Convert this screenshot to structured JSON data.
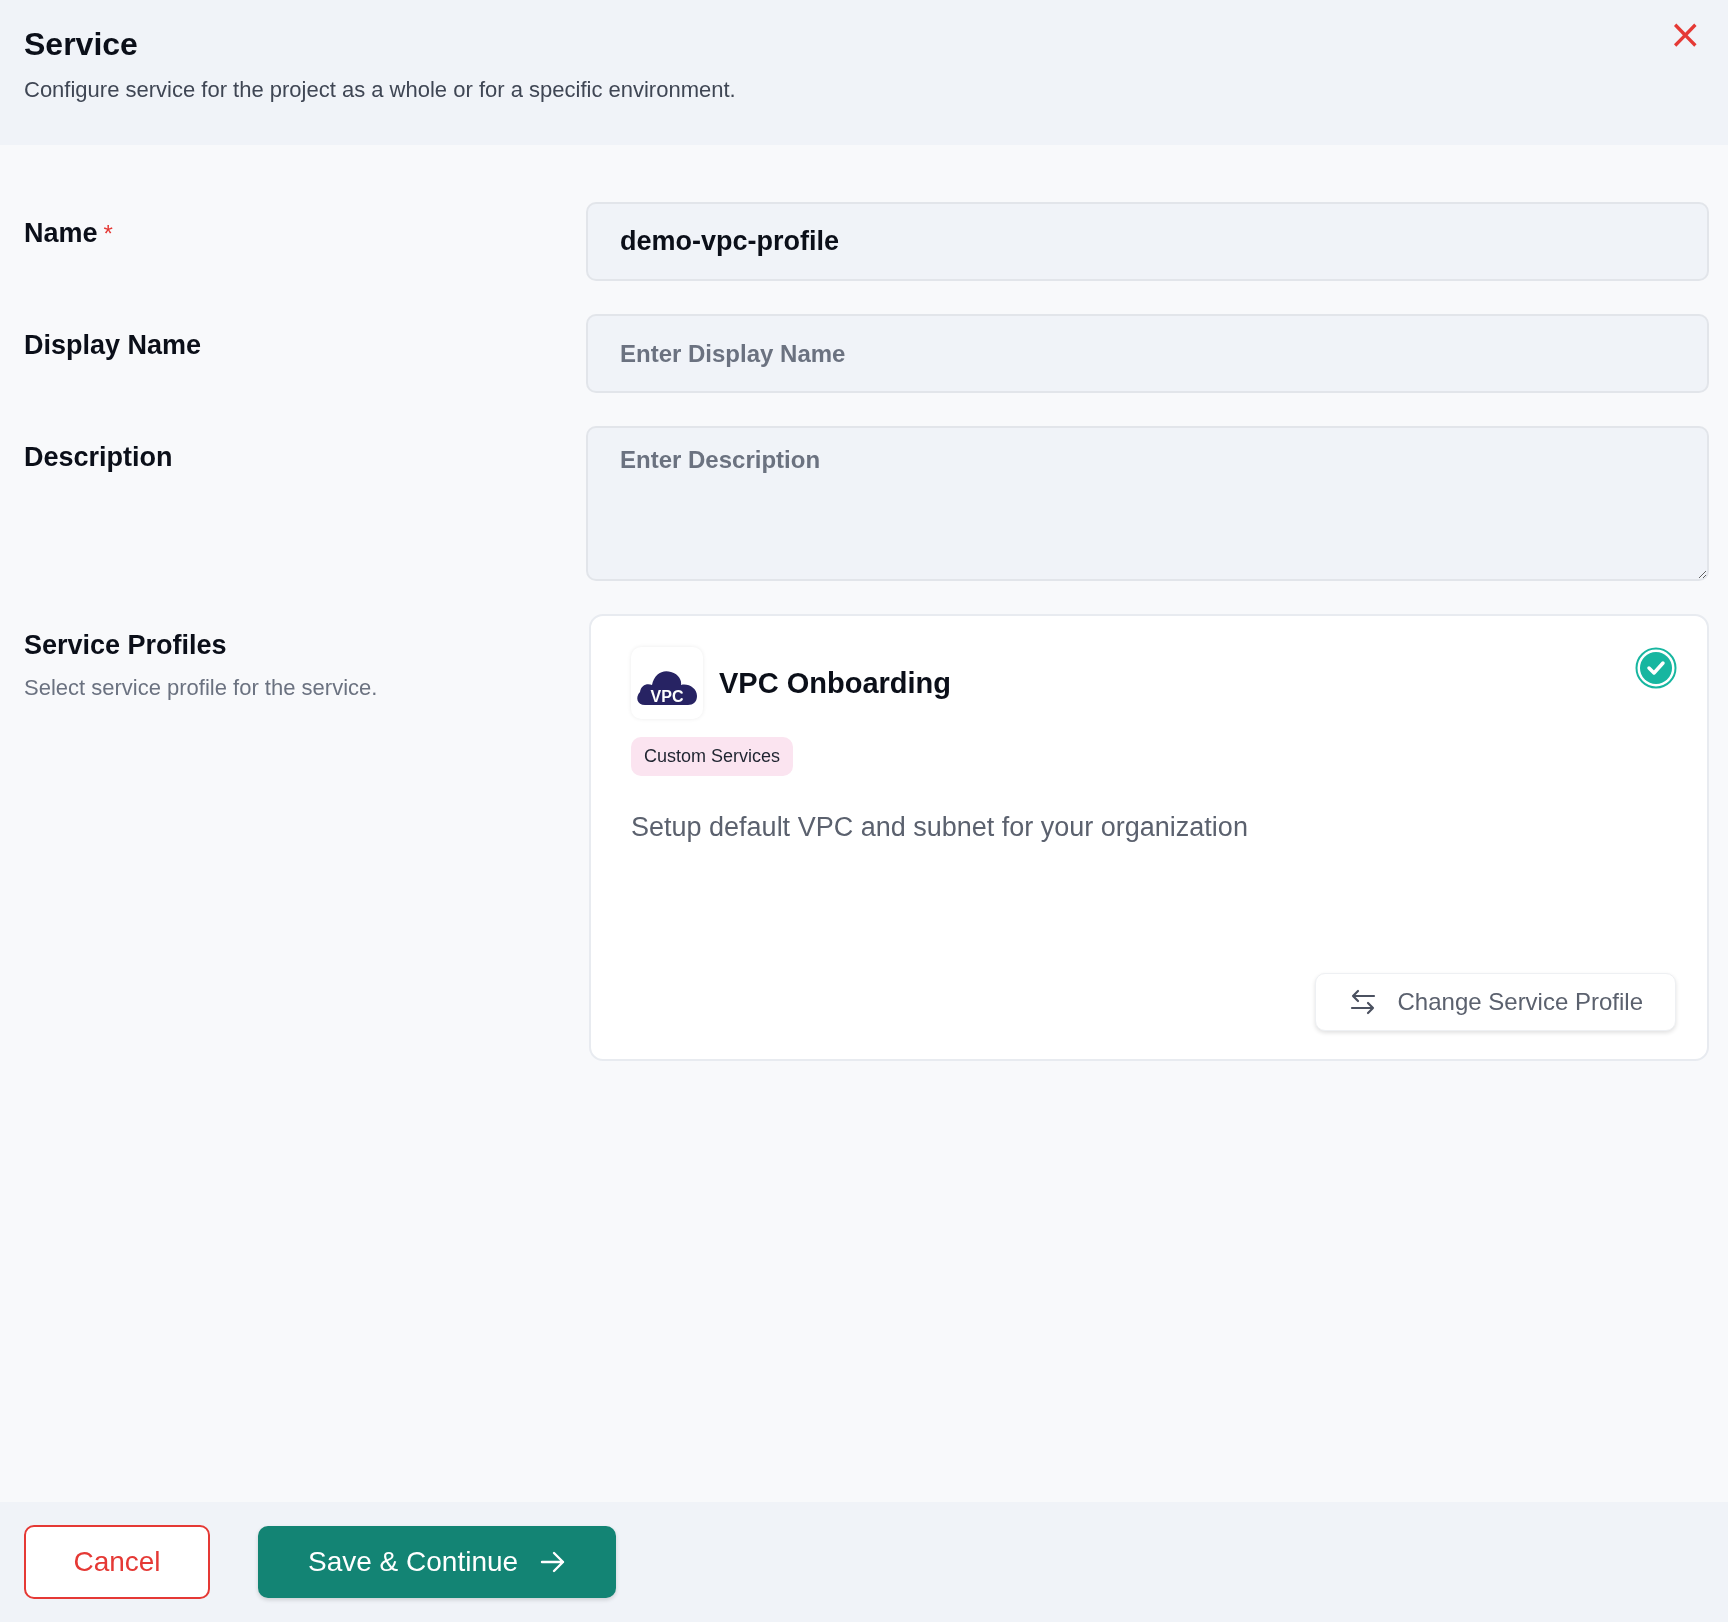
{
  "header": {
    "title": "Service",
    "subtitle": "Configure service for the project as a whole or for a specific environment.",
    "close": "×"
  },
  "fields": [
    {
      "kind": "input",
      "label": "Name",
      "required_mark": "*",
      "value": "demo-vpc-profile"
    },
    {
      "kind": "input",
      "label": "Display Name",
      "placeholder": "Enter Display Name"
    },
    {
      "kind": "textarea",
      "label": "Description",
      "placeholder": "Enter Description"
    }
  ],
  "service_profiles": {
    "label": "Service Profiles",
    "hint": "Select service profile for the service.",
    "card": {
      "logo_text": "VPC",
      "title": "VPC Onboarding",
      "tag": "Custom Services",
      "description": "Setup default VPC and subnet for your organization",
      "selected": true,
      "change_button": "Change Service Profile"
    }
  },
  "footer": {
    "cancel": "Cancel",
    "save": "Save & Continue"
  }
}
